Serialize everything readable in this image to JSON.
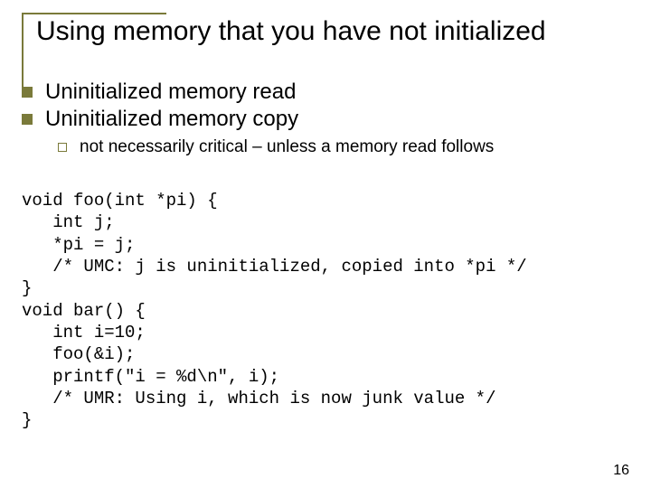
{
  "title": "Using memory that you have not\ninitialized",
  "bullets": [
    "Uninitialized memory read",
    "Uninitialized memory copy"
  ],
  "sub_bullet": "not necessarily critical – unless a memory read follows",
  "code": "void foo(int *pi) {\n   int j;\n   *pi = j;\n   /* UMC: j is uninitialized, copied into *pi */\n}\nvoid bar() {\n   int i=10;\n   foo(&i);\n   printf(\"i = %d\\n\", i);\n   /* UMR: Using i, which is now junk value */\n}",
  "page_number": "16"
}
